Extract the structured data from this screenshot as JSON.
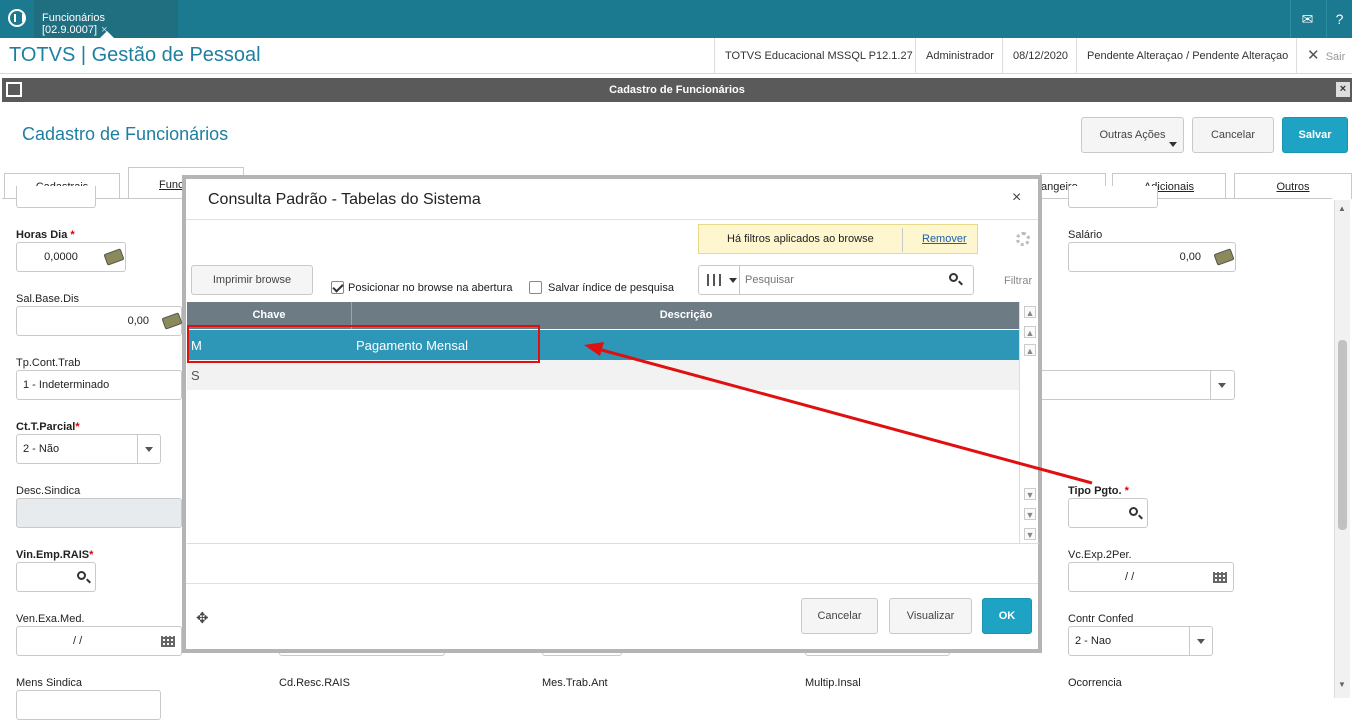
{
  "topbar": {
    "tab_label": "Funcionários [02.9.0007]",
    "tab_close": "×",
    "mail_icon": "envelope-icon",
    "help_icon": "question-icon"
  },
  "header": {
    "app_title": "TOTVS | Gestão de Pessoal",
    "environment": "TOTVS Educacional MSSQL P12.1.27",
    "user": "Administrador",
    "date": "08/12/2020",
    "status": "Pendente Alteraçao / Pendente Alteraçao",
    "exit_label": "Sair"
  },
  "window": {
    "title": "Cadastro de Funcionários",
    "close": "×"
  },
  "page": {
    "title": "Cadastro de Funcionários",
    "actions_label": "Outras Ações",
    "cancel_label": "Cancelar",
    "save_label": "Salvar"
  },
  "tabs": [
    {
      "label": "Cadastrais"
    },
    {
      "label": "Func"
    },
    {
      "label": "angeiro"
    },
    {
      "label": "Adicionais"
    },
    {
      "label": "Outros"
    }
  ],
  "form": {
    "horas_dia": {
      "label": "Horas Dia",
      "value": "0,0000"
    },
    "sal_base": {
      "label": "Sal.Base.Dis",
      "value": "0,00"
    },
    "tp_cont": {
      "label": "Tp.Cont.Trab",
      "value": "1 - Indeterminado"
    },
    "ct_parcial": {
      "label": "Ct.T.Parcial",
      "value": "2 - Não"
    },
    "desc_sindica": {
      "label": "Desc.Sindica"
    },
    "vin_emp": {
      "label": "Vin.Emp.RAIS"
    },
    "ven_exa": {
      "label": "Ven.Exa.Med.",
      "value": "/ /"
    },
    "mens_sindica": {
      "label": "Mens Sindica"
    },
    "cd_resc": {
      "label": "Cd.Resc.RAIS"
    },
    "mes_trab": {
      "label": "Mes.Trab.Ant"
    },
    "multip": {
      "label": "Multip.Insal"
    },
    "salario": {
      "label": "Salário",
      "value": "0,00"
    },
    "tipo_pgto": {
      "label": "Tipo Pgto."
    },
    "vc_exp": {
      "label": "Vc.Exp.2Per.",
      "value": "/ /"
    },
    "contr_confed": {
      "label": "Contr Confed",
      "value": "2 - Nao"
    },
    "ocorrencia": {
      "label": "Ocorrencia"
    },
    "required_mark": "*"
  },
  "modal": {
    "title": "Consulta Padrão - Tabelas do Sistema",
    "close": "×",
    "filter_notice": "Há filtros aplicados ao browse",
    "filter_remove": "Remover",
    "print_label": "Imprimir browse",
    "check_position": "Posicionar no browse na abertura",
    "check_position_checked": true,
    "check_save_index": "Salvar índice de pesquisa",
    "check_save_index_checked": false,
    "search_placeholder": "Pesquisar",
    "filter_label": "Filtrar",
    "columns": [
      "Chave",
      "Descrição"
    ],
    "rows": [
      {
        "key": "M",
        "description": "Pagamento Mensal",
        "selected": true
      },
      {
        "key": "S",
        "description": "",
        "selected": false
      }
    ],
    "cancel_label": "Cancelar",
    "view_label": "Visualizar",
    "ok_label": "OK"
  },
  "colors": {
    "topbar": "#1b7a8f",
    "accent": "#1f7fa0",
    "primary_button": "#1fa3c4",
    "selected_row": "#2e97b7",
    "annotation": "#e01010"
  }
}
